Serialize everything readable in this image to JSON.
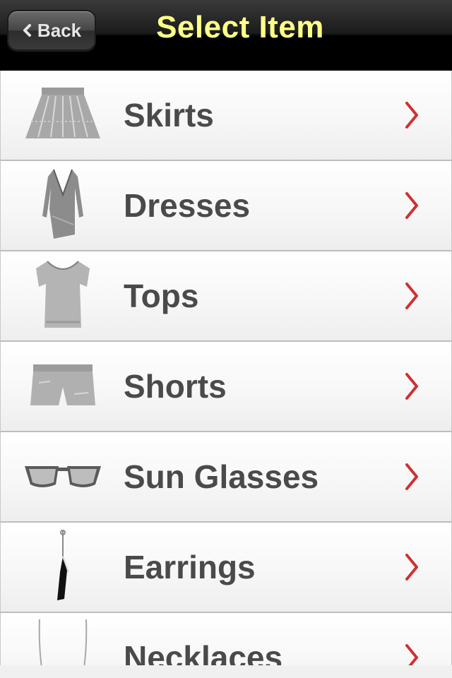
{
  "navbar": {
    "back_label": "Back",
    "title": "Select Item",
    "title_color": "#ffff88"
  },
  "items": [
    {
      "label": "Skirts",
      "icon": "skirt-icon"
    },
    {
      "label": "Dresses",
      "icon": "dress-icon"
    },
    {
      "label": "Tops",
      "icon": "top-icon"
    },
    {
      "label": "Shorts",
      "icon": "shorts-icon"
    },
    {
      "label": "Sun Glasses",
      "icon": "sunglasses-icon"
    },
    {
      "label": "Earrings",
      "icon": "earring-icon"
    },
    {
      "label": "Necklaces",
      "icon": "necklace-icon"
    }
  ],
  "accent_arrow_color": "#d03030"
}
